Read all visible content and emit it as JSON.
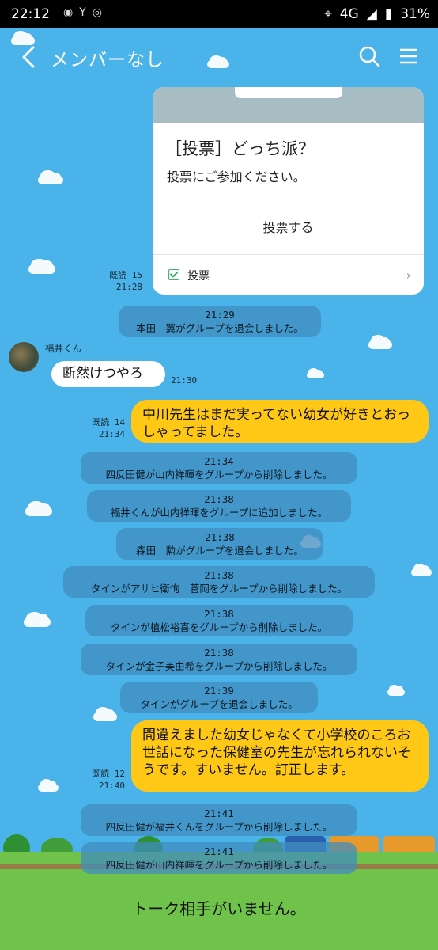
{
  "status_bar": {
    "time": "22:12",
    "network": "4G",
    "battery": "31%",
    "icons": [
      "location-icon",
      "signal-icon",
      "battery-icon"
    ]
  },
  "header": {
    "title": "メンバーなし",
    "icons": [
      "back-icon",
      "search-icon",
      "menu-icon"
    ]
  },
  "poll_card": {
    "title": "［投票］どっち派？",
    "description": "投票にご参加ください。",
    "action": "投票する",
    "footer_label": "投票",
    "read": "既読 15",
    "time": "21:28"
  },
  "messages": [
    {
      "time": "21:29",
      "text": "本田　翼がグループを退会しました。"
    },
    {
      "time": "21:34",
      "text": "四反田健が山内祥暉をグループから削除しました。"
    },
    {
      "time": "21:38",
      "text": "福井くんが山内祥暉をグループに追加しました。"
    },
    {
      "time": "21:38",
      "text": "森田　勲がグループを退会しました。"
    },
    {
      "time": "21:38",
      "text": "タインがアサヒ衛恂　菅岡をグループから削除しました。"
    },
    {
      "time": "21:38",
      "text": "タインが植松裕喜をグループから削除しました。"
    },
    {
      "time": "21:38",
      "text": "タインが金子美由希をグループから削除しました。"
    },
    {
      "time": "21:39",
      "text": "タインがグループを退会しました。"
    },
    {
      "time": "21:41",
      "text": "四反田健が福井くんをグループから削除しました。"
    },
    {
      "time": "21:41",
      "text": "四反田健が山内祥暉をグループから削除しました。"
    }
  ],
  "incoming": {
    "sender": "福井くん",
    "text": "断然けつやろ",
    "time": "21:30"
  },
  "outgoing": [
    {
      "read": "既読 14",
      "time": "21:34",
      "text": "中川先生はまだ実ってない幼女が好きとおっしゃってました。"
    },
    {
      "read": "既読 12",
      "time": "21:40",
      "text": "間違えました幼女じゃなくて小学校のころお世話になった保健室の先生が忘れられないそうです。すいません。訂正します。"
    }
  ],
  "footer": {
    "no_partner": "トーク相手がいません。"
  },
  "colors": {
    "background": "#49b3ea",
    "bubble_outgoing": "#ffc816",
    "system_pill": "#428cbe"
  }
}
